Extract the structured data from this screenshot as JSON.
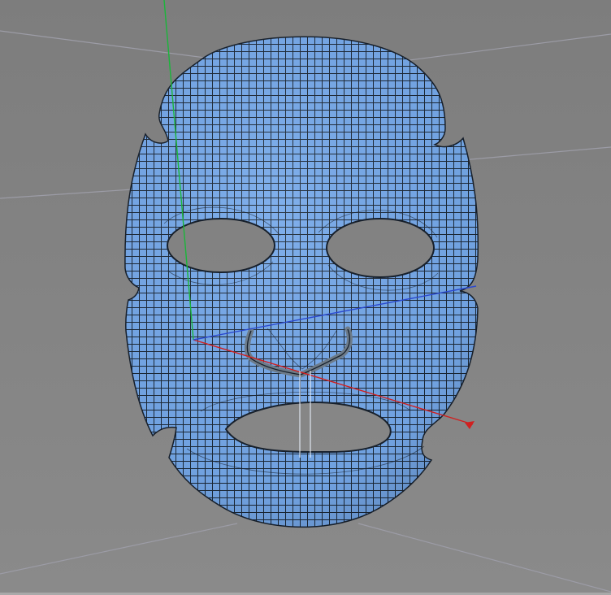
{
  "viewport": {
    "background_color": "#808080",
    "grid_color": "#9c9ca6",
    "mesh_color": "#76a9ea",
    "wire_color": "#17202c",
    "cut_color": "#6d7b89",
    "axis_colors": {
      "x": "#d02020",
      "y": "#19b63a",
      "z": "#2a49d0"
    }
  }
}
